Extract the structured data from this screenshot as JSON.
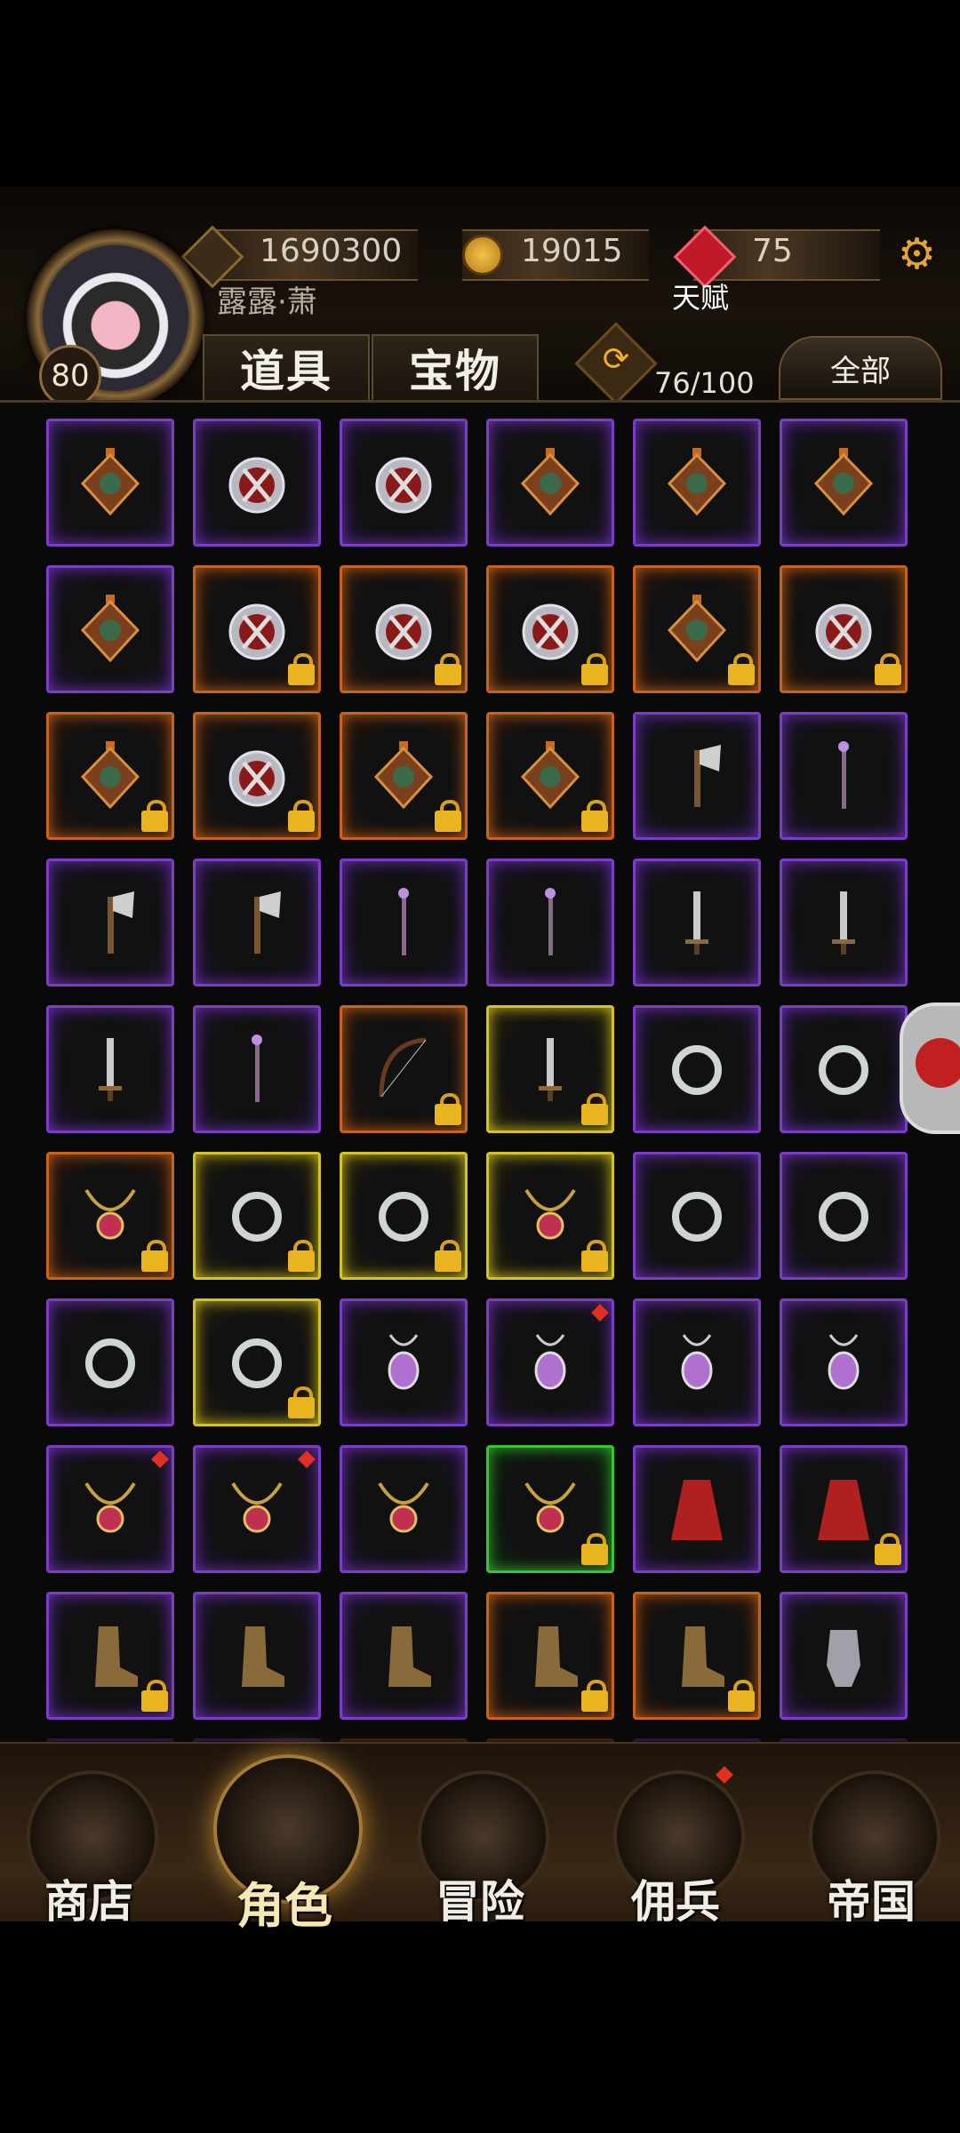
{
  "player": {
    "level": "80",
    "name": "露露·萧"
  },
  "resources": {
    "gold_bar": "1690300",
    "coins": "19015",
    "gems": "75",
    "talent_label": "天赋"
  },
  "tabs": [
    {
      "label": "道具"
    },
    {
      "label": "宝物"
    }
  ],
  "inventory": {
    "capacity": "76/100",
    "filter_label": "全部"
  },
  "colors": {
    "purple": "#7a3fc0",
    "orange": "#c4641e",
    "yellow": "#d2c22e",
    "green": "#39c23a"
  },
  "slots": [
    {
      "icon": "music-amulet-icon",
      "rarity": "purple",
      "locked": false
    },
    {
      "icon": "crossed-swords-medal-icon",
      "rarity": "purple",
      "locked": false
    },
    {
      "icon": "shield-medal-icon",
      "rarity": "purple",
      "locked": false
    },
    {
      "icon": "armor-amulet-icon",
      "rarity": "purple",
      "locked": false
    },
    {
      "icon": "snowflake-amulet-icon",
      "rarity": "purple",
      "locked": false
    },
    {
      "icon": "rune-amulet-icon",
      "rarity": "purple",
      "locked": false
    },
    {
      "icon": "helmet-amulet-icon",
      "rarity": "purple",
      "locked": false
    },
    {
      "icon": "crossed-swords-medal-icon",
      "rarity": "orange",
      "locked": true
    },
    {
      "icon": "sword-medal-icon",
      "rarity": "orange",
      "locked": true
    },
    {
      "icon": "crossed-swords-medal-icon",
      "rarity": "orange",
      "locked": true
    },
    {
      "icon": "armor-amulet-icon",
      "rarity": "orange",
      "locked": true
    },
    {
      "icon": "sword-medal-icon",
      "rarity": "orange",
      "locked": true
    },
    {
      "icon": "bell-amulet-icon",
      "rarity": "orange",
      "locked": true
    },
    {
      "icon": "crest-medal-icon",
      "rarity": "orange",
      "locked": true
    },
    {
      "icon": "gem-amulet-icon",
      "rarity": "orange",
      "locked": true
    },
    {
      "icon": "anchor-amulet-icon",
      "rarity": "orange",
      "locked": true
    },
    {
      "icon": "axe-icon",
      "rarity": "purple",
      "locked": false
    },
    {
      "icon": "staff-icon",
      "rarity": "purple",
      "locked": false
    },
    {
      "icon": "axe-icon",
      "rarity": "purple",
      "locked": false
    },
    {
      "icon": "battle-axe-icon",
      "rarity": "purple",
      "locked": false
    },
    {
      "icon": "mace-icon",
      "rarity": "purple",
      "locked": false
    },
    {
      "icon": "scepter-icon",
      "rarity": "purple",
      "locked": false
    },
    {
      "icon": "sword-icon",
      "rarity": "purple",
      "locked": false
    },
    {
      "icon": "sword-icon",
      "rarity": "purple",
      "locked": false
    },
    {
      "icon": "dagger-icon",
      "rarity": "purple",
      "locked": false
    },
    {
      "icon": "lantern-mace-icon",
      "rarity": "purple",
      "locked": false
    },
    {
      "icon": "bow-icon",
      "rarity": "orange",
      "locked": true
    },
    {
      "icon": "spear-icon",
      "rarity": "yellow",
      "locked": true
    },
    {
      "icon": "ring-icon",
      "rarity": "purple",
      "locked": false
    },
    {
      "icon": "ring-icon",
      "rarity": "purple",
      "locked": false
    },
    {
      "icon": "feather-charm-icon",
      "rarity": "orange",
      "locked": true
    },
    {
      "icon": "ring-icon",
      "rarity": "yellow",
      "locked": true
    },
    {
      "icon": "ruby-ring-icon",
      "rarity": "yellow",
      "locked": true
    },
    {
      "icon": "sapphire-necklace-icon",
      "rarity": "yellow",
      "locked": true
    },
    {
      "icon": "emerald-ring-icon",
      "rarity": "purple",
      "locked": false
    },
    {
      "icon": "topaz-ring-icon",
      "rarity": "purple",
      "locked": false
    },
    {
      "icon": "ruby-band-icon",
      "rarity": "purple",
      "locked": false
    },
    {
      "icon": "emerald-ring-icon",
      "rarity": "yellow",
      "locked": true
    },
    {
      "icon": "amethyst-pendant-icon",
      "rarity": "purple",
      "locked": false
    },
    {
      "icon": "amethyst-pendant-icon",
      "rarity": "purple",
      "locked": false,
      "new": true
    },
    {
      "icon": "sapphire-pendant-icon",
      "rarity": "purple",
      "locked": false
    },
    {
      "icon": "tree-pendant-icon",
      "rarity": "purple",
      "locked": false
    },
    {
      "icon": "flower-necklace-icon",
      "rarity": "purple",
      "locked": false,
      "new": true
    },
    {
      "icon": "flower-necklace-icon",
      "rarity": "purple",
      "locked": false,
      "new": true
    },
    {
      "icon": "ruby-necklace-icon",
      "rarity": "purple",
      "locked": false
    },
    {
      "icon": "garnet-necklace-icon",
      "rarity": "green",
      "locked": true
    },
    {
      "icon": "cloak-icon",
      "rarity": "purple",
      "locked": false
    },
    {
      "icon": "red-cape-icon",
      "rarity": "purple",
      "locked": true
    },
    {
      "icon": "leather-boot-icon",
      "rarity": "purple",
      "locked": true
    },
    {
      "icon": "blue-boot-icon",
      "rarity": "purple",
      "locked": false
    },
    {
      "icon": "gold-boot-icon",
      "rarity": "purple",
      "locked": false
    },
    {
      "icon": "steel-boot-icon",
      "rarity": "orange",
      "locked": true
    },
    {
      "icon": "fur-boot-icon",
      "rarity": "orange",
      "locked": true
    },
    {
      "icon": "gauntlet-icon",
      "rarity": "purple",
      "locked": false
    },
    {
      "icon": "hidden-item-icon",
      "rarity": "purple",
      "locked": false
    },
    {
      "icon": "hidden-item-icon",
      "rarity": "purple",
      "locked": false
    },
    {
      "icon": "hidden-item-icon",
      "rarity": "orange",
      "locked": false
    },
    {
      "icon": "hidden-item-icon",
      "rarity": "orange",
      "locked": false
    },
    {
      "icon": "hidden-item-icon",
      "rarity": "purple",
      "locked": false
    },
    {
      "icon": "hidden-item-icon",
      "rarity": "purple",
      "locked": false
    }
  ],
  "nav": [
    {
      "label": "商店",
      "icon": "castle-icon",
      "active": false
    },
    {
      "label": "角色",
      "icon": "hooded-hero-icon",
      "active": true
    },
    {
      "label": "冒险",
      "icon": "crossed-swords-icon",
      "active": false
    },
    {
      "label": "佣兵",
      "icon": "cards-icon",
      "active": false,
      "badge": true
    },
    {
      "label": "帝国",
      "icon": "crown-icon",
      "active": false
    }
  ]
}
